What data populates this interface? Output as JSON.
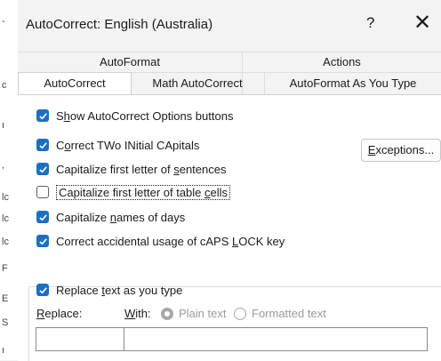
{
  "window": {
    "title": "AutoCorrect: English (Australia)",
    "help_label": "?",
    "close_label": "✕"
  },
  "edge_chars": [
    "-",
    "c",
    "ı",
    ",",
    "lc",
    "lc",
    "lc",
    "F",
    "E",
    "S",
    "ı"
  ],
  "tabs_top": [
    {
      "label": "AutoFormat"
    },
    {
      "label": "Actions"
    }
  ],
  "tabs_bottom": [
    {
      "label": "AutoCorrect",
      "active": true
    },
    {
      "label": "Math AutoCorrect",
      "active": false
    },
    {
      "label": "AutoFormat As You Type",
      "active": false
    }
  ],
  "options": {
    "show_buttons": {
      "pre": "S",
      "key": "h",
      "post": "ow AutoCorrect Options buttons",
      "checked": true
    },
    "two_initial": {
      "pre": "C",
      "key": "o",
      "post": "rrect TWo INitial CApitals",
      "checked": true
    },
    "first_letter_sentences": {
      "pre": "Capitalize first letter of ",
      "key": "s",
      "post": "entences",
      "checked": true
    },
    "first_letter_table": {
      "pre": "Capitalize first letter of table ",
      "key": "c",
      "post": "ells",
      "checked": false
    },
    "names_of_days": {
      "pre": "Capitalize ",
      "key": "n",
      "post": "ames of days",
      "checked": true
    },
    "caps_lock": {
      "pre": "Correct accidental usage of cAPS ",
      "key": "L",
      "post": "OCK key",
      "checked": true
    }
  },
  "exceptions": {
    "key": "E",
    "post": "xceptions..."
  },
  "replace_group": {
    "replace_text": {
      "pre": "Replace ",
      "key": "t",
      "post": "ext as you type",
      "checked": true
    },
    "replace_label": {
      "key": "R",
      "post": "eplace:"
    },
    "with_label": {
      "key": "W",
      "post": "ith:"
    },
    "plain_text": "Plain text",
    "formatted_text": "Formatted text",
    "replace_value": "",
    "with_value": ""
  },
  "colors": {
    "accent": "#1b6fc3",
    "dialog_bg": "#f3f3f3",
    "panel_bg": "#ffffff"
  }
}
